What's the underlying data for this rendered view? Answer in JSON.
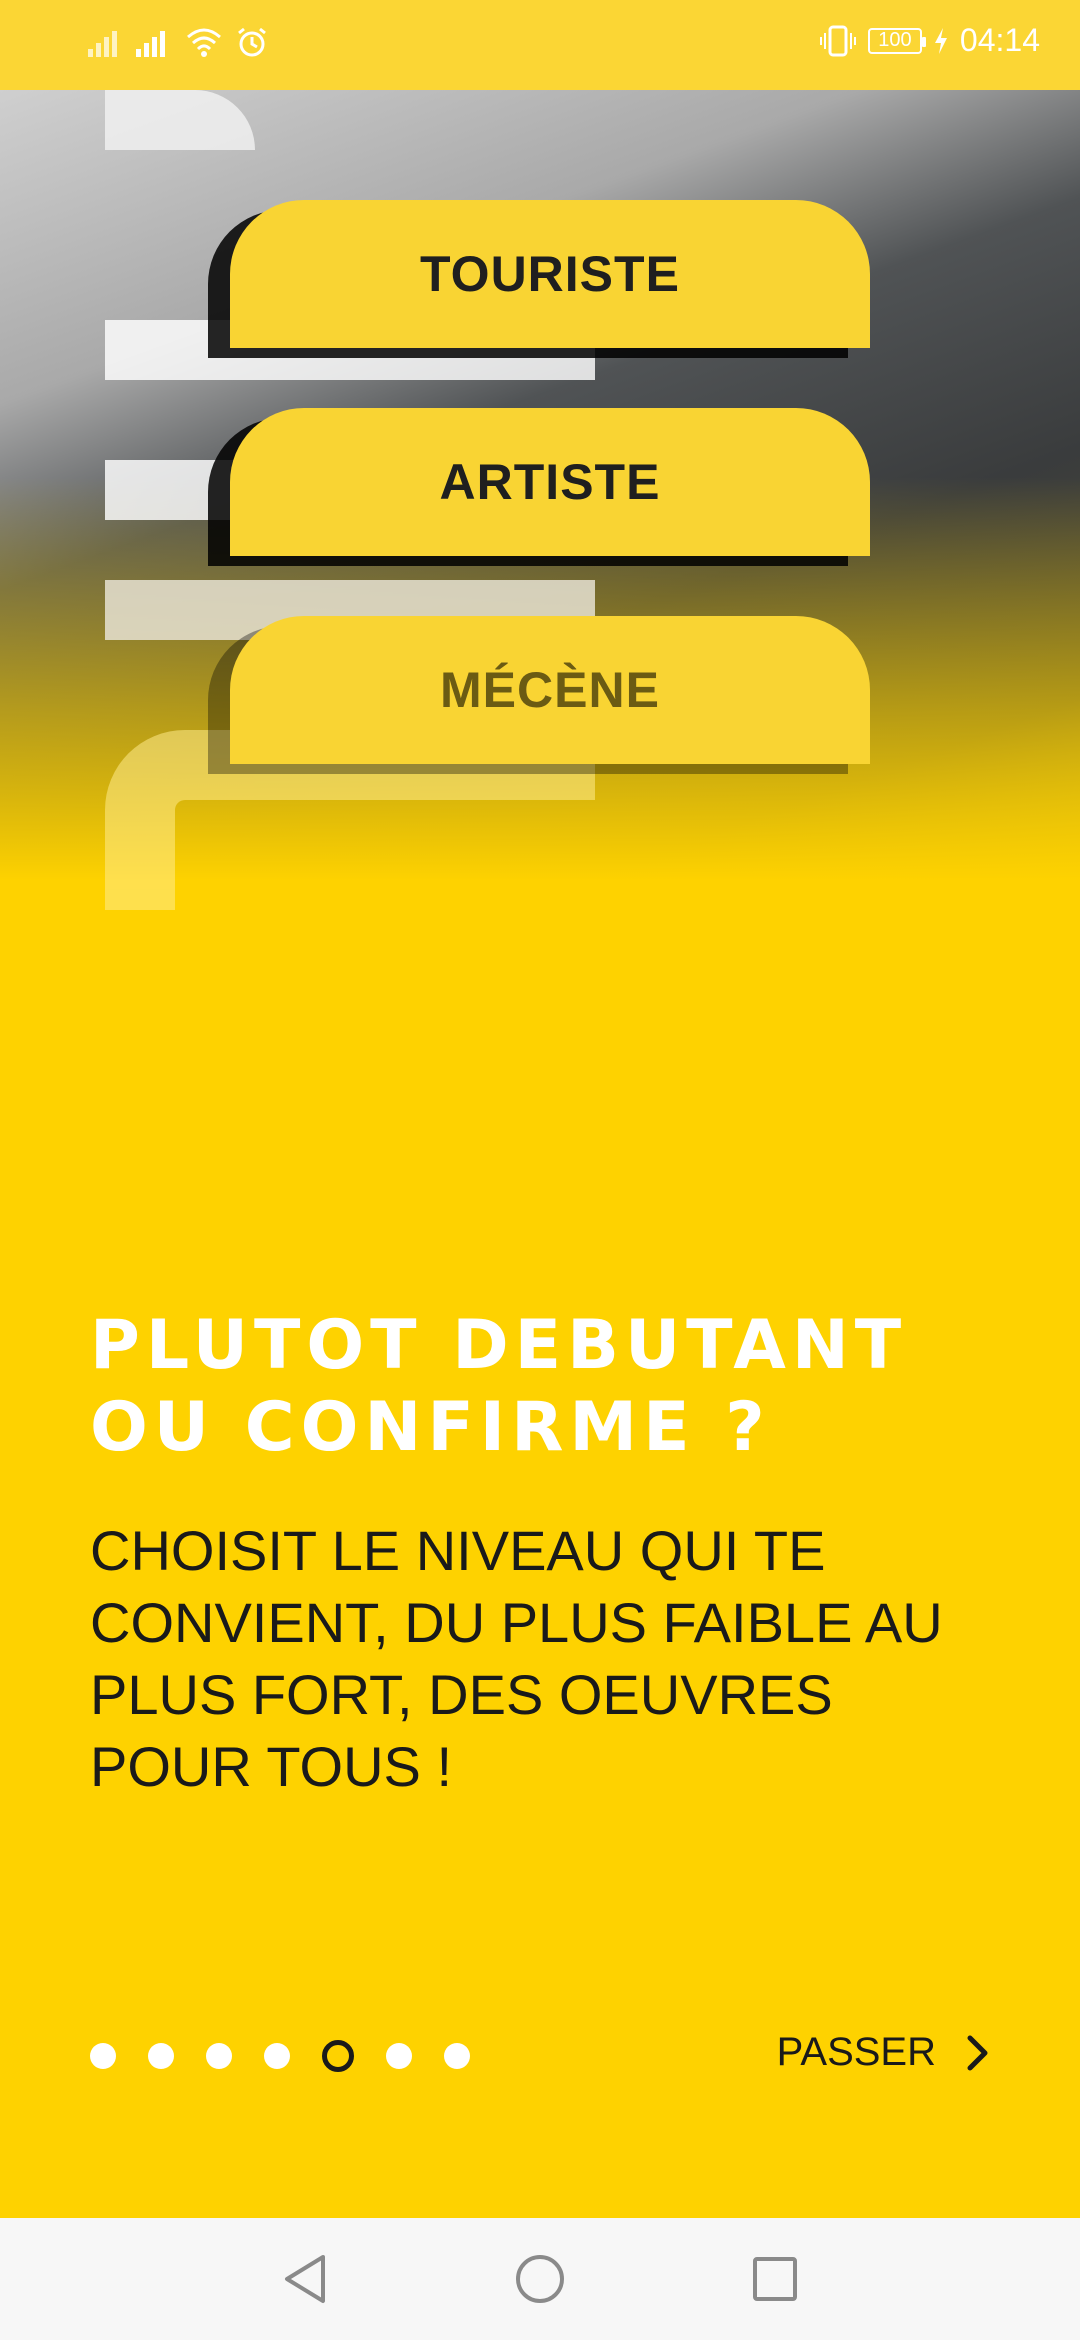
{
  "status_bar": {
    "time": "04:14",
    "battery": "100",
    "icons": [
      "signal-icon",
      "signal-icon",
      "wifi-icon",
      "alarm-icon",
      "vibrate-icon",
      "battery-icon",
      "charging-icon"
    ]
  },
  "hero": {
    "buttons": [
      "TOURISTE",
      "ARTISTE",
      "MÉCÈNE"
    ]
  },
  "content": {
    "title": "PLUTOT DEBUTANT OU CONFIRME ?",
    "description": "CHOISIT LE NIVEAU QUI TE CONVIENT, DU PLUS FAIBLE AU PLUS FORT, DES OEUVRES POUR TOUS !"
  },
  "pager": {
    "total": 7,
    "active_index": 4
  },
  "skip": {
    "label": "PASSER"
  },
  "nav_bar": {
    "icons": [
      "back-icon",
      "home-icon",
      "recents-icon"
    ]
  },
  "colors": {
    "background": "#FED200",
    "status_bar": "#FBD634",
    "button": "#F9D433",
    "text_dark": "#1a1a1a",
    "text_light": "#ffffff"
  }
}
